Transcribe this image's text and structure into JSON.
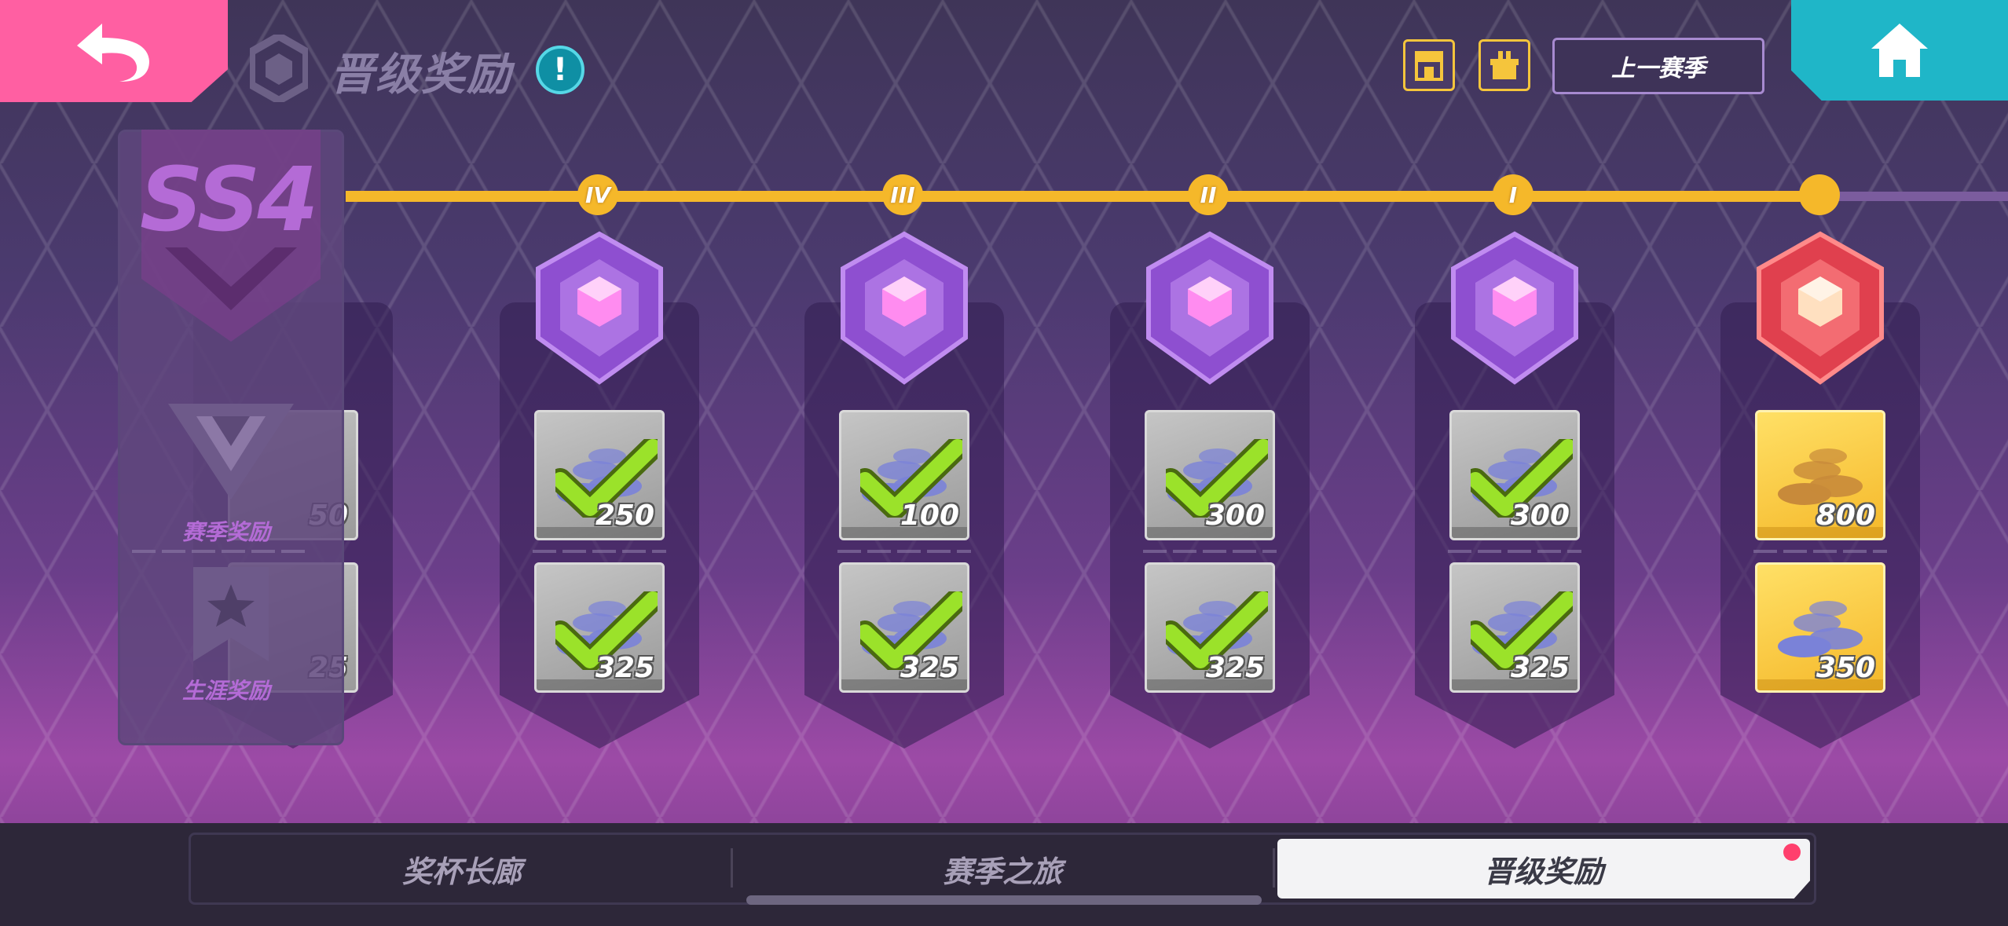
{
  "header": {
    "title": "晋级奖励",
    "info_icon": "!",
    "prev_season_label": "上一赛季",
    "icons": [
      "back-arrow-icon",
      "shop-icon",
      "gift-box-icon",
      "home-icon"
    ]
  },
  "side_panel": {
    "season": "SS4",
    "season_reward_label": "赛季奖励",
    "career_reward_label": "生涯奖励"
  },
  "track": {
    "nodes": [
      "IV",
      "III",
      "II",
      "I"
    ]
  },
  "columns": [
    {
      "rank_icon": "purple-rank-badge-icon",
      "season_reward": "250",
      "career_reward": "325",
      "claimed": true
    },
    {
      "rank_icon": "purple-rank-badge-icon",
      "season_reward": "100",
      "career_reward": "325",
      "claimed": true
    },
    {
      "rank_icon": "purple-rank-badge-icon",
      "season_reward": "300",
      "career_reward": "325",
      "claimed": true
    },
    {
      "rank_icon": "purple-rank-badge-icon",
      "season_reward": "300",
      "career_reward": "325",
      "claimed": true
    },
    {
      "rank_icon": "red-rank-badge-icon",
      "season_reward": "800",
      "career_reward": "350",
      "claimed": false
    }
  ],
  "partial_column": {
    "season_reward": "50",
    "career_reward": "25"
  },
  "tabs": [
    {
      "label": "奖杯长廊",
      "active": false
    },
    {
      "label": "赛季之旅",
      "active": false
    },
    {
      "label": "晋级奖励",
      "active": true
    }
  ],
  "colors": {
    "accent": "#f5b82a",
    "back": "#ff5fa2",
    "home": "#1fb6c8",
    "check": "#9be22a"
  }
}
